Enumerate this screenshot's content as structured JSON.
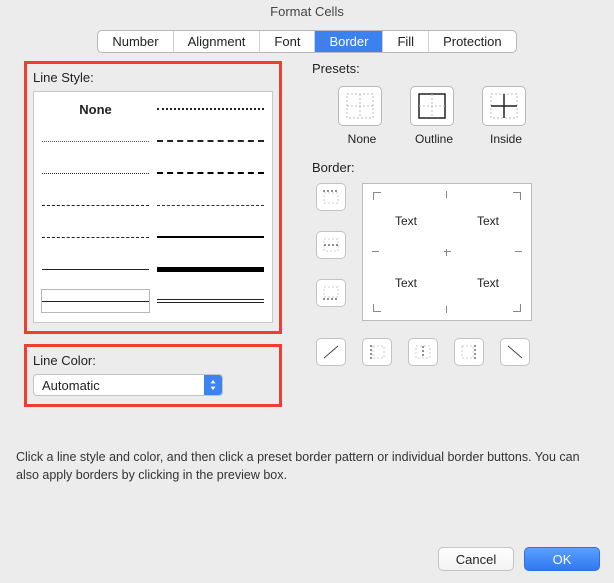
{
  "title": "Format Cells",
  "tabs": [
    "Number",
    "Alignment",
    "Font",
    "Border",
    "Fill",
    "Protection"
  ],
  "active_tab": "Border",
  "line_style_label": "Line Style:",
  "line_style_none": "None",
  "line_color_label": "Line Color:",
  "line_color_value": "Automatic",
  "presets_label": "Presets:",
  "presets": {
    "none": "None",
    "outline": "Outline",
    "inside": "Inside"
  },
  "border_label": "Border:",
  "preview_text": "Text",
  "help_text": "Click a line style and color, and then click a preset border pattern or individual border buttons. You can also apply borders by clicking in the preview box.",
  "buttons": {
    "cancel": "Cancel",
    "ok": "OK"
  }
}
